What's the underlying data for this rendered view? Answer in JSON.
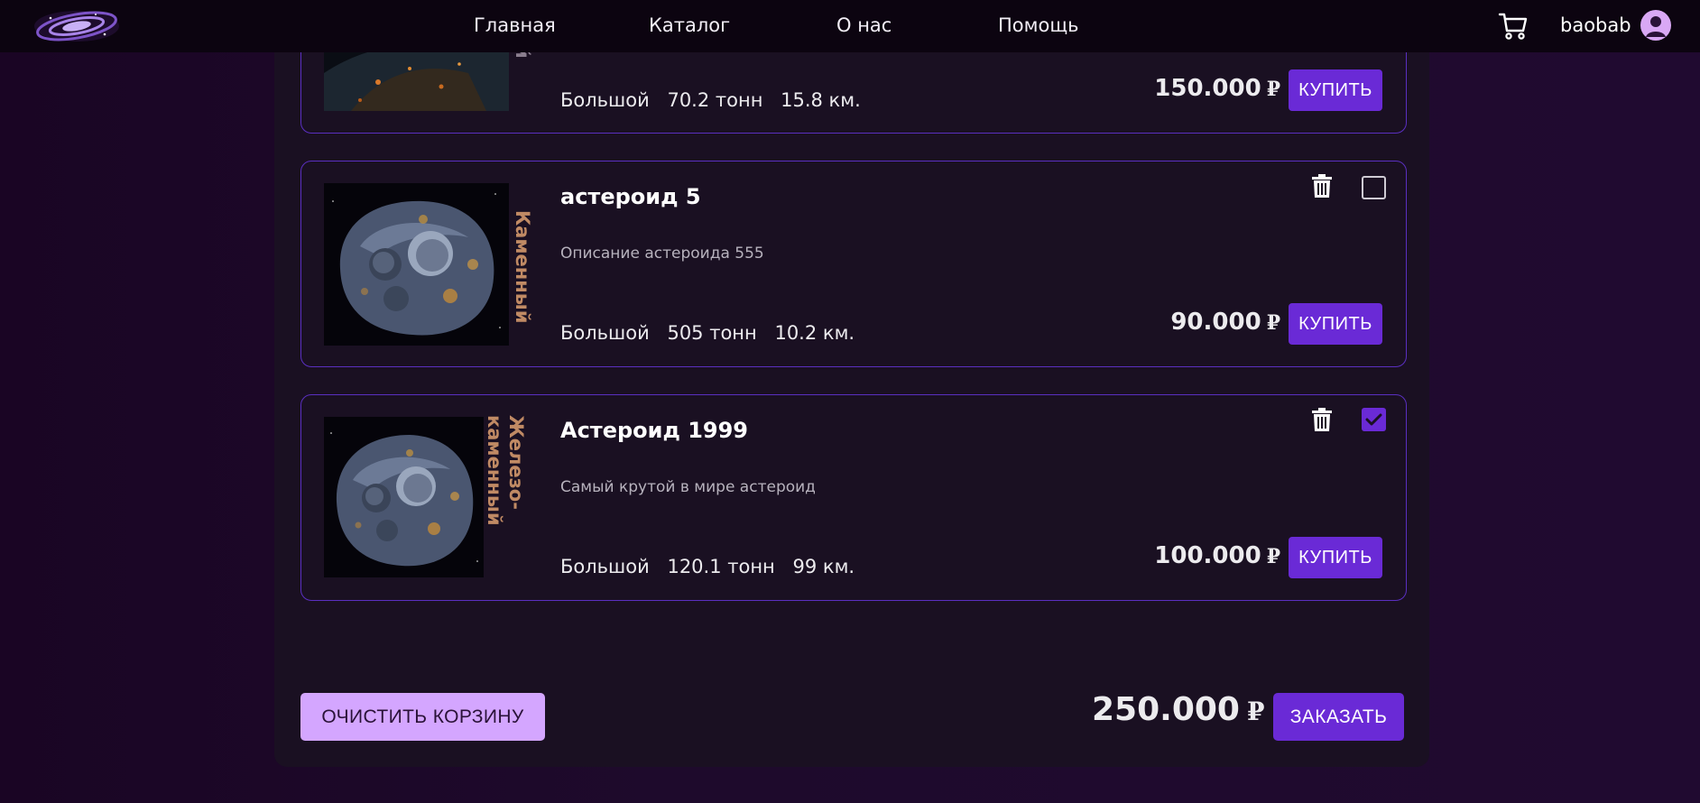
{
  "header": {
    "logo": "galaxy-logo",
    "nav": [
      "Главная",
      "Каталог",
      "О нас",
      "Помощь"
    ],
    "username": "baobab"
  },
  "cart": {
    "items": [
      {
        "title": "",
        "description": "",
        "type": "ый",
        "size": "Большой",
        "mass": "70.2 тонн",
        "diameter": "15.8 км.",
        "price": "150.000",
        "currency": "₽",
        "buy_label": "КУПИТЬ",
        "checked": false
      },
      {
        "title": "астероид 5",
        "description": "Описание астероида 555",
        "type": "Каменный",
        "size": "Большой",
        "mass": "505 тонн",
        "diameter": "10.2 км.",
        "price": "90.000",
        "currency": "₽",
        "buy_label": "КУПИТЬ",
        "checked": false
      },
      {
        "title": "Астероид 1999",
        "description": "Самый крутой в мире астероид",
        "type": "Железо-\nкаменный",
        "size": "Большой",
        "mass": "120.1 тонн",
        "diameter": "99 км.",
        "price": "100.000",
        "currency": "₽",
        "buy_label": "КУПИТЬ",
        "checked": true
      }
    ],
    "clear_label": "ОЧИСТИТЬ КОРЗИНУ",
    "total": "250.000",
    "currency": "₽",
    "order_label": "ЗАКАЗАТЬ"
  },
  "colors": {
    "accent": "#6a2ad6",
    "card_border": "#5a2fc0",
    "clear_button": "#d4a6ff",
    "type_label": "#c08a64",
    "header_bg": "#0c0410",
    "panel_bg": "#1a1022"
  },
  "icons": [
    "cart-icon",
    "user-avatar-icon",
    "trash-icon",
    "checkbox-icon",
    "check-icon"
  ]
}
